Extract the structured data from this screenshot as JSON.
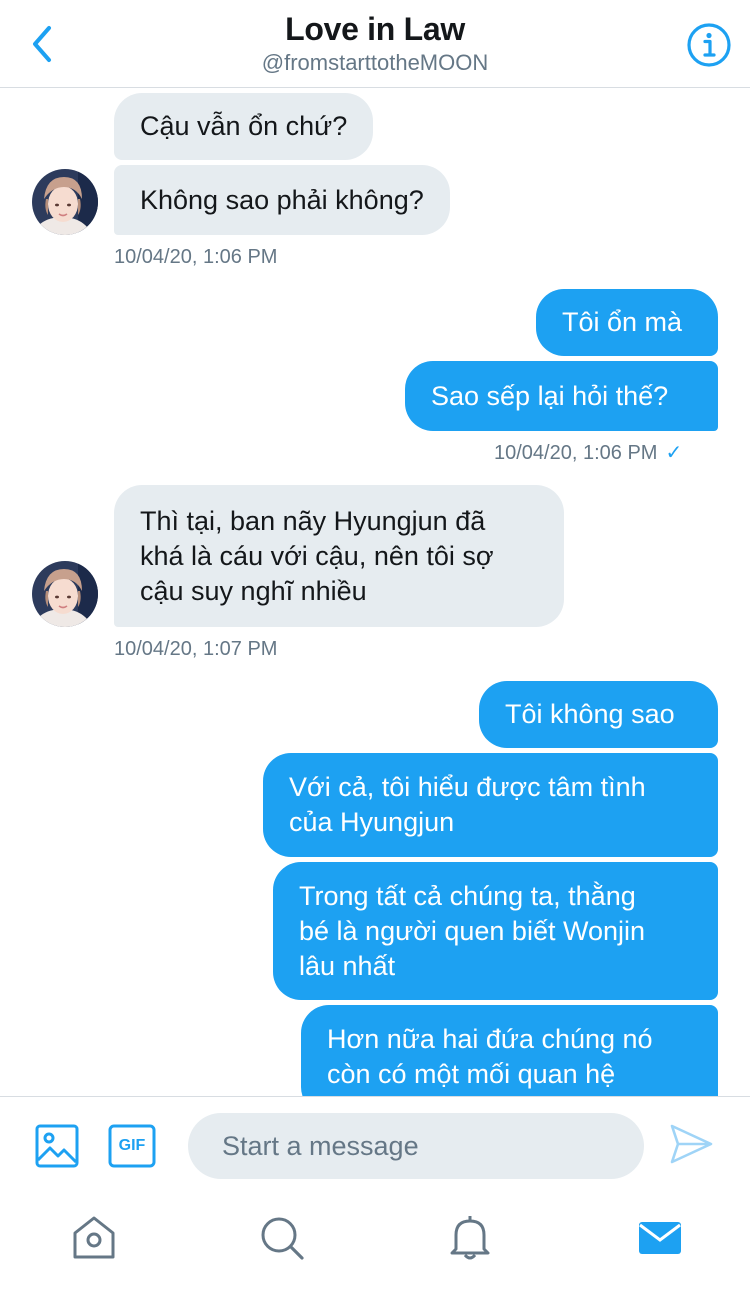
{
  "header": {
    "title": "Love in Law",
    "handle": "@fromstarttotheMOON"
  },
  "messages": {
    "group1": [
      "Cậu vẫn ổn chứ?",
      "Không sao phải không?"
    ],
    "ts1": "10/04/20, 1:06 PM",
    "group2": [
      "Tôi ổn mà",
      "Sao sếp lại hỏi thế?"
    ],
    "ts2": "10/04/20, 1:06 PM",
    "group3": {
      "line1": "Thì tại, ban nãy Hyungjun đã",
      "line2": "khá là cáu với cậu, nên tôi sợ",
      "line3": "cậu suy nghĩ nhiều"
    },
    "ts3": "10/04/20, 1:07 PM",
    "group4": {
      "m1": "Tôi không sao",
      "m2_line1": "Với cả, tôi hiểu được tâm tình",
      "m2_line2": "của Hyungjun",
      "m3_line1": "Trong tất cả chúng ta, thằng",
      "m3_line2": "bé là người quen biết Wonjin",
      "m3_line3": "lâu nhất",
      "m4_line1": "Hơn nữa hai đứa chúng nó",
      "m4_line2": "còn có một mối quan hệ"
    },
    "read_mark": "✓"
  },
  "composer": {
    "placeholder": "Start a message",
    "gif_label": "GIF"
  },
  "colors": {
    "accent": "#1da1f2",
    "incoming_bubble": "#e6ecf0",
    "secondary_text": "#657786"
  },
  "icons": {
    "back": "chevron-left-icon",
    "info": "info-icon",
    "image": "image-icon",
    "gif": "gif-icon",
    "send": "send-icon",
    "home": "home-icon",
    "search": "search-icon",
    "notifications": "bell-icon",
    "messages": "mail-icon"
  }
}
